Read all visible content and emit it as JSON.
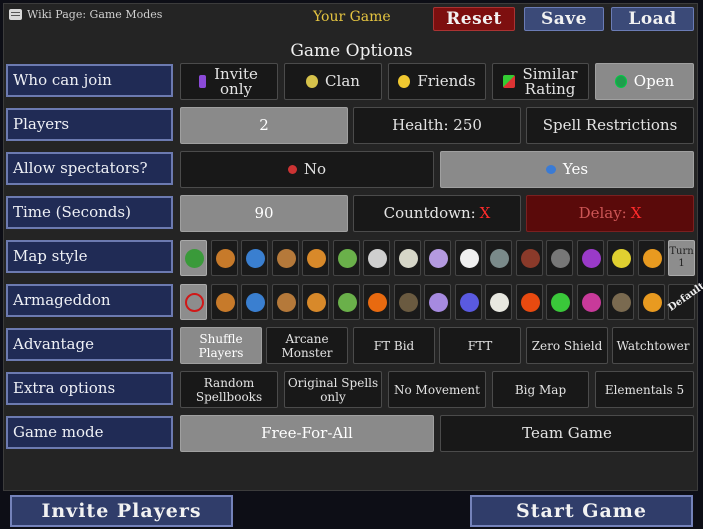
{
  "header": {
    "wiki_link": "Wiki Page: Game Modes",
    "your_game": "Your Game",
    "reset": "Reset",
    "save": "Save",
    "load": "Load"
  },
  "title": "Game Options",
  "rows": {
    "who_can_join": {
      "label": "Who can join",
      "options": [
        "Invite only",
        "Clan",
        "Friends",
        "Similar Rating",
        "Open"
      ],
      "selected": "Open"
    },
    "players": {
      "label": "Players",
      "value": "2",
      "health": "Health: 250",
      "spell_restrictions": "Spell Restrictions"
    },
    "spectators": {
      "label": "Allow spectators?",
      "no": "No",
      "yes": "Yes",
      "selected": "Yes"
    },
    "time": {
      "label": "Time (Seconds)",
      "value": "90",
      "countdown": "Countdown:",
      "countdown_mark": "X",
      "delay": "Delay:",
      "delay_mark": "X"
    },
    "map_style": {
      "label": "Map style",
      "icons": [
        "tree-icon",
        "figure-icon",
        "orb-icon",
        "crystal-cluster-icon",
        "flame-figure-icon",
        "swirl-icon",
        "castle-icon",
        "shell-icon",
        "gem-pair-icon",
        "cloud-icon",
        "anchor-icon",
        "tower-icon",
        "gear-icon",
        "portal-icon",
        "bananas-icon",
        "cycle-icon"
      ],
      "turn_label": "Turn 1"
    },
    "armageddon": {
      "label": "Armageddon",
      "icons": [
        "none-icon",
        "figure-icon",
        "orb-icon",
        "crystal-cluster-icon",
        "flame-figure-icon",
        "swirl-icon",
        "lava-icon",
        "rock-icon",
        "bubbles-icon",
        "cubes-icon",
        "boulders-icon",
        "fire-spray-icon",
        "vines-icon",
        "demon-icon",
        "bat-icon",
        "cycle-icon"
      ],
      "default_label": "Default"
    },
    "advantage": {
      "label": "Advantage",
      "options": [
        "Shuffle Players",
        "Arcane Monster",
        "FT Bid",
        "FTT",
        "Zero Shield",
        "Watchtower"
      ],
      "selected": "Shuffle Players"
    },
    "extra_options": {
      "label": "Extra options",
      "options": [
        "Random Spellbooks",
        "Original Spells only",
        "No Movement",
        "Big Map",
        "Elementals 5"
      ]
    },
    "game_mode": {
      "label": "Game mode",
      "options": [
        "Free-For-All",
        "Team Game"
      ],
      "selected": "Free-For-All"
    }
  },
  "footer": {
    "invite": "Invite Players",
    "start": "Start Game"
  },
  "colors": {
    "accent_gold": "#e4c440",
    "label_bg": "#202b55",
    "selected_bg": "#8a8a8a",
    "danger": "#7d0f0f"
  }
}
